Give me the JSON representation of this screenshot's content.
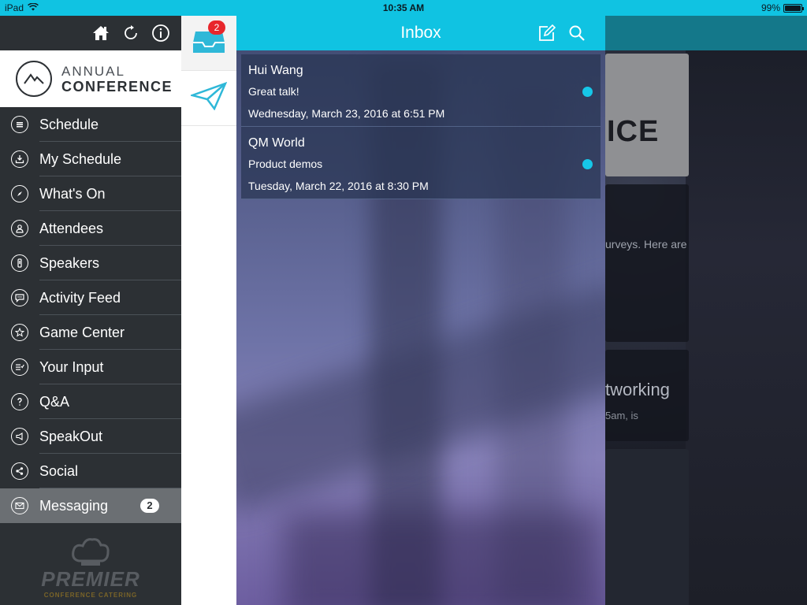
{
  "status_bar": {
    "device": "iPad",
    "time": "10:35 AM",
    "battery": "99%",
    "battery_level": 0.99
  },
  "background": {
    "card1_text": "ICE",
    "card2_text": "urveys. Here are",
    "card3_title": "tworking",
    "card3_sub": "5am, is"
  },
  "menu": {
    "header_icons": [
      "home-icon",
      "refresh-icon",
      "info-icon"
    ],
    "logo": {
      "line1": "ANNUAL",
      "line2": "CONFERENCE"
    },
    "items": [
      {
        "label": "Schedule",
        "icon": "list-icon"
      },
      {
        "label": "My Schedule",
        "icon": "download-icon"
      },
      {
        "label": "What's On",
        "icon": "compass-icon"
      },
      {
        "label": "Attendees",
        "icon": "person-icon"
      },
      {
        "label": "Speakers",
        "icon": "microphone-icon"
      },
      {
        "label": "Activity Feed",
        "icon": "chat-icon"
      },
      {
        "label": "Game Center",
        "icon": "star-icon"
      },
      {
        "label": "Your Input",
        "icon": "checklist-icon"
      },
      {
        "label": "Q&A",
        "icon": "question-icon"
      },
      {
        "label": "SpeakOut",
        "icon": "megaphone-icon"
      },
      {
        "label": "Social",
        "icon": "share-icon"
      },
      {
        "label": "Messaging",
        "icon": "envelope-icon",
        "badge": "2",
        "active": true
      }
    ],
    "sponsor": {
      "name": "PREMIER",
      "sub": "CONFERENCE CATERING"
    }
  },
  "icon_column": {
    "inbox_badge": "2"
  },
  "inbox": {
    "title": "Inbox",
    "messages": [
      {
        "sender": "Hui Wang",
        "subject": "Great talk!",
        "date": "Wednesday, March 23, 2016 at 6:51 PM",
        "unread": true
      },
      {
        "sender": "QM World",
        "subject": "Product demos",
        "date": "Tuesday, March 22, 2016 at 8:30 PM",
        "unread": true
      }
    ]
  },
  "colors": {
    "accent": "#10c3e2",
    "menu_bg": "#2c3034",
    "badge_red": "#e8262b",
    "unread_dot": "#16c7e8"
  }
}
